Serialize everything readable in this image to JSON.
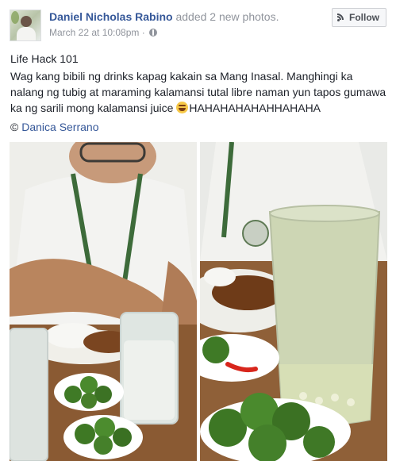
{
  "post": {
    "author": "Daniel Nicholas Rabino",
    "action": "added 2 new photos.",
    "timestamp": "March 22 at 10:08pm",
    "separator": "·",
    "follow_label": "Follow",
    "title": "Life Hack 101",
    "caption_before_emoji": "Wag kang bibili ng drinks kapag kakain sa Mang Inasal. Manghingi ka nalang ng tubig at maraming kalamansi tutal libre naman yun tapos gumawa ka ng sarili mong kalamansi juice ",
    "caption_after_emoji": "HAHAHAHAHAHHAHAHA",
    "credit_symbol": "©",
    "credit_name": "Danica Serrano"
  },
  "icons": {
    "avatar": "profile-photo",
    "privacy": "globe-icon",
    "follow": "rss-icon",
    "emoji": "laughing-emoji"
  },
  "colors": {
    "link": "#365899",
    "meta": "#90949c",
    "text": "#1d2129",
    "button_bg": "#f6f7f9"
  }
}
